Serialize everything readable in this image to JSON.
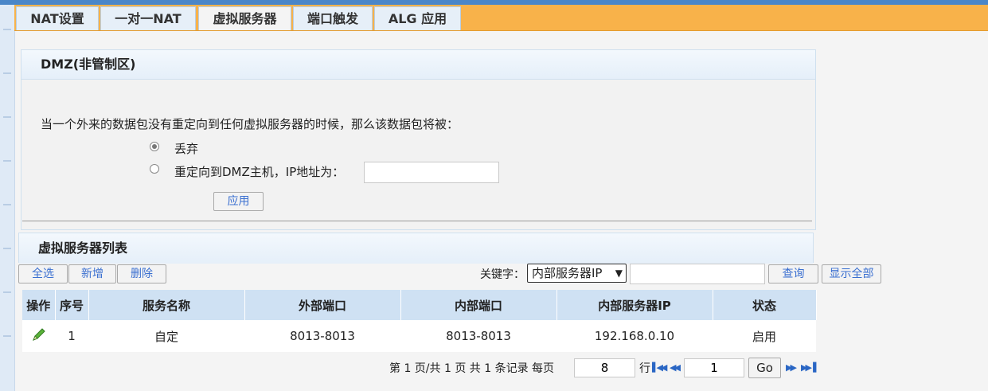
{
  "tabs": [
    {
      "label": "NAT设置"
    },
    {
      "label": "一对一NAT"
    },
    {
      "label": "虚拟服务器"
    },
    {
      "label": "端口触发"
    },
    {
      "label": "ALG 应用"
    }
  ],
  "dmz": {
    "title": "DMZ(非管制区)",
    "description": "当一个外来的数据包没有重定向到任何虚拟服务器的时候，那么该数据包将被：",
    "option_drop": "丢弃",
    "option_redirect": "重定向到DMZ主机，IP地址为：",
    "ip_value": "",
    "apply_label": "应用"
  },
  "vs_list": {
    "title": "虚拟服务器列表",
    "select_all": "全选",
    "add": "新增",
    "delete": "删除",
    "keyword_label": "关键字：",
    "keyword_selected": "内部服务器IP",
    "keyword_value": "",
    "query": "查询",
    "show_all": "显示全部",
    "columns": [
      "操作",
      "序号",
      "服务名称",
      "外部端口",
      "内部端口",
      "内部服务器IP",
      "状态"
    ],
    "rows": [
      {
        "index": "1",
        "name": "自定",
        "ext_port": "8013-8013",
        "int_port": "8013-8013",
        "ip": "192.168.0.10",
        "status": "启用"
      }
    ]
  },
  "pager": {
    "summary": "第 1 页/共 1 页 共 1 条记录 每页",
    "per_page": "8",
    "rows_label": "行",
    "page": "1",
    "go": "Go"
  },
  "colors": {
    "tabbar": "#f8b24a",
    "header": "#cfe1f3",
    "link": "#3a6fd0",
    "edit_icon": "#3a9a2a"
  }
}
